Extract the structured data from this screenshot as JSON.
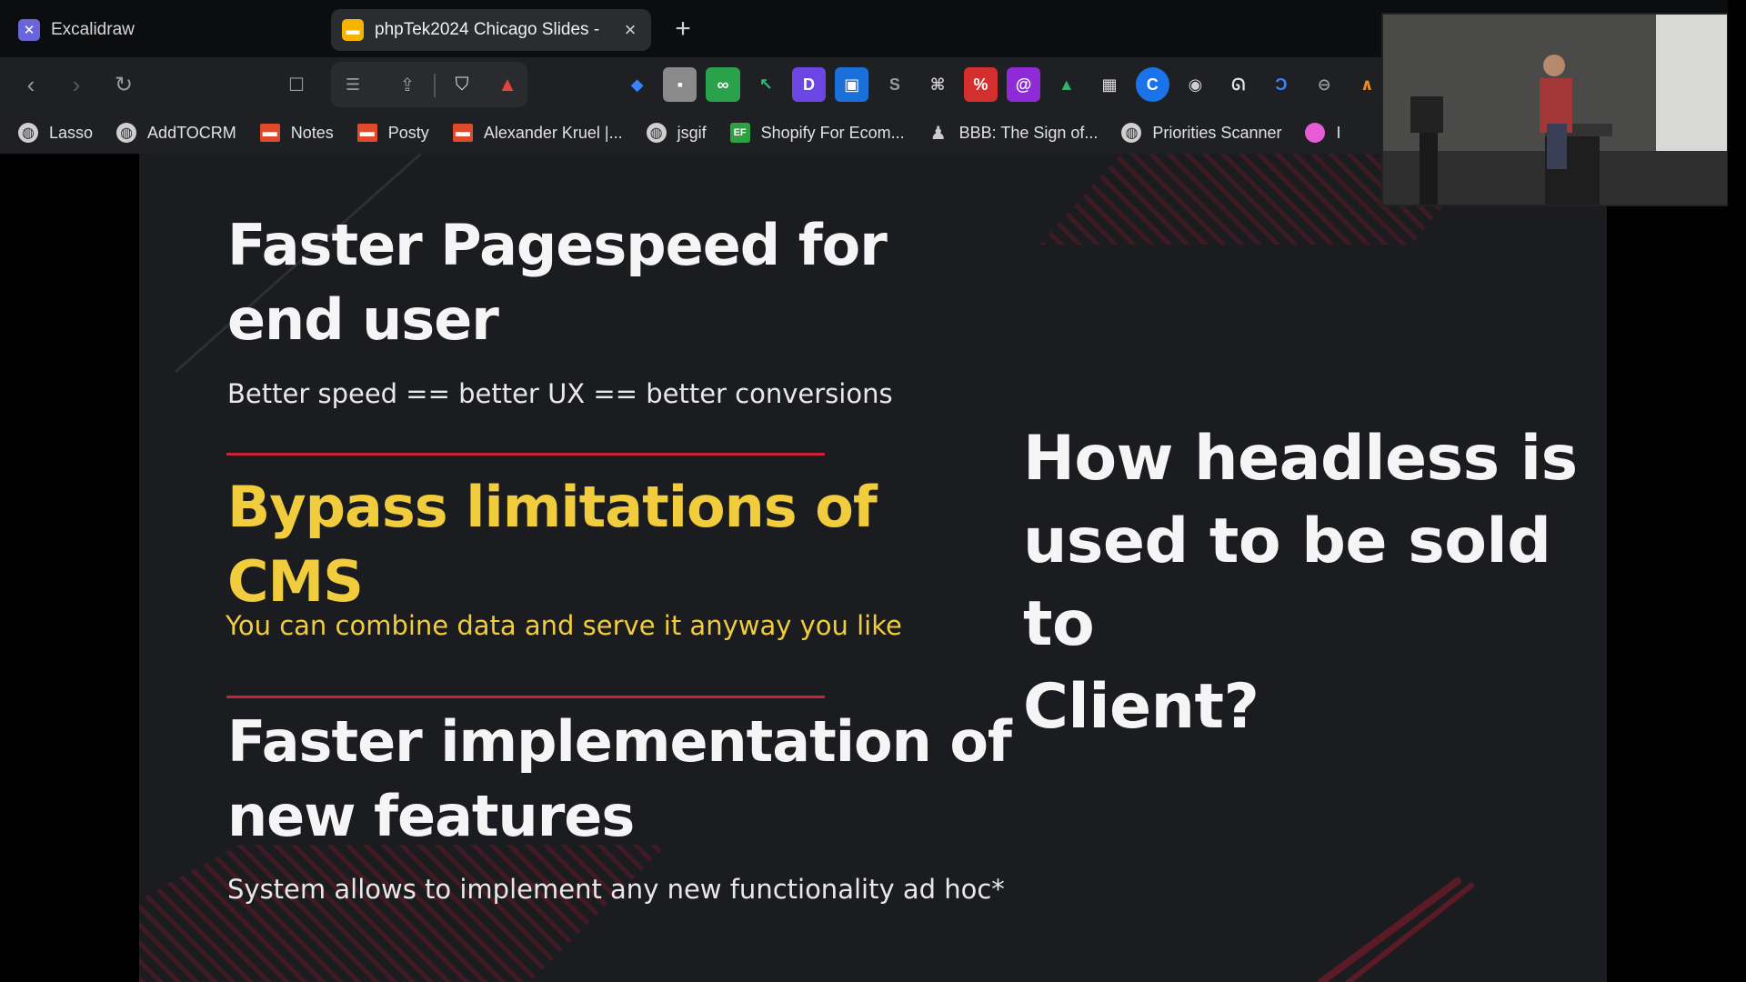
{
  "browser": {
    "tabs": [
      {
        "title": "Excalidraw",
        "favicon": "excalidraw-icon",
        "active": false
      },
      {
        "title": "phpTek2024 Chicago Slides -",
        "favicon": "google-slides-icon",
        "active": true
      }
    ],
    "new_tab": "+",
    "close_glyph": "×"
  },
  "toolbar": {
    "back": "‹",
    "forward": "›",
    "reload": "↻",
    "bookmark": "☐",
    "extensions": [
      "tag-icon",
      "square-icon",
      "glasses-icon",
      "cursor-icon",
      "d-icon",
      "book-icon",
      "shopify-icon",
      "command-icon",
      "percent-icon",
      "spiral-icon",
      "chart-icon",
      "toolbox-icon",
      "c-icon",
      "camera-icon",
      "fingerprint-icon",
      "d-arrow-icon",
      "minus-circle-icon",
      "wave-icon"
    ]
  },
  "bookmarks": [
    {
      "label": "Lasso",
      "icon": "globe-icon"
    },
    {
      "label": "AddTOCRM",
      "icon": "globe-icon"
    },
    {
      "label": "Notes",
      "icon": "flag-icon"
    },
    {
      "label": "Posty",
      "icon": "flag-icon"
    },
    {
      "label": "Alexander Kruel |...",
      "icon": "flag-icon"
    },
    {
      "label": "jsgif",
      "icon": "globe-icon"
    },
    {
      "label": "Shopify For Ecom...",
      "icon": "ef-icon"
    },
    {
      "label": "BBB: The Sign of...",
      "icon": "pin-icon"
    },
    {
      "label": "Priorities Scanner",
      "icon": "globe-icon"
    },
    {
      "label": "I",
      "icon": "pink-icon"
    }
  ],
  "slide": {
    "left": {
      "heading1_line1": "Faster Pagespeed for",
      "heading1_line2": "end user",
      "sub1": "Better speed == better UX == better conversions",
      "heading2_line1": "Bypass limitations of",
      "heading2_line2": "CMS",
      "sub2": "You can combine data and serve it anyway you like",
      "heading3_line1": "Faster implementation of",
      "heading3_line2": "new features",
      "sub3": "System allows to implement any new functionality ad hoc*"
    },
    "right": {
      "line1": "How headless is",
      "line2": "used to be sold to",
      "line3": "Client?"
    },
    "colors": {
      "accent_red": "#c8233a",
      "accent_yellow": "#f1cc3c",
      "background": "#1b1c20"
    }
  }
}
